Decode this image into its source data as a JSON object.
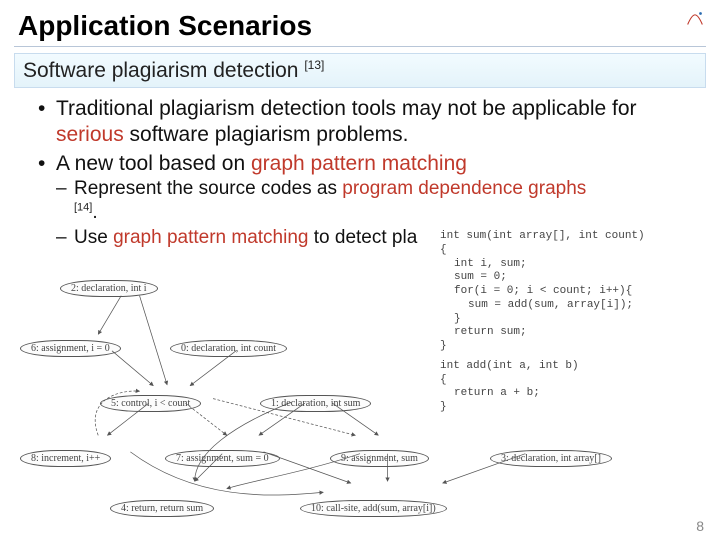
{
  "title": "Application Scenarios",
  "subtitle": {
    "text": "Software plagiarism detection ",
    "citation": "[13]"
  },
  "bullets": {
    "b1_a": "Traditional plagiarism detection tools may not be applicable for ",
    "b1_accent": "serious",
    "b1_b": " software plagiarism problems.",
    "b2_a": "A new tool based on ",
    "b2_accent": "graph pattern matching",
    "sub1_a": "Represent the source codes as ",
    "sub1_accent": "program dependence graphs",
    "sub1_cit": "[14]",
    "sub1_dot": ".",
    "sub2_a": "Use ",
    "sub2_accent": "graph pattern matching",
    "sub2_b": " to detect pla"
  },
  "code": {
    "sig": "int sum(int array[], int count)",
    "l1": "{",
    "l2": "int i, sum;",
    "l3": "sum = 0;",
    "l4": "for(i = 0; i < count; i++){",
    "l5": "  sum = add(sum, array[i]);",
    "l6": "}",
    "l7": "return sum;",
    "l8": "}",
    "sig2": "int add(int a, int b)",
    "l9": "{",
    "l10": "return a + b;",
    "l11": "}"
  },
  "nodes": {
    "n2": "2: declaration, int i",
    "n6": "6: assignment, i = 0",
    "n0": "0: declaration, int count",
    "n5": "5: control, i < count",
    "n1": "1: declaration, int sum",
    "n8": "8: increment, i++",
    "n7": "7: assignment, sum = 0",
    "n9": "9: assignment, sum",
    "n3": "3: declaration, int array[]",
    "n4": "4: return, return sum",
    "n10": "10: call-site, add(sum, array[i])"
  },
  "slide_number": "8"
}
